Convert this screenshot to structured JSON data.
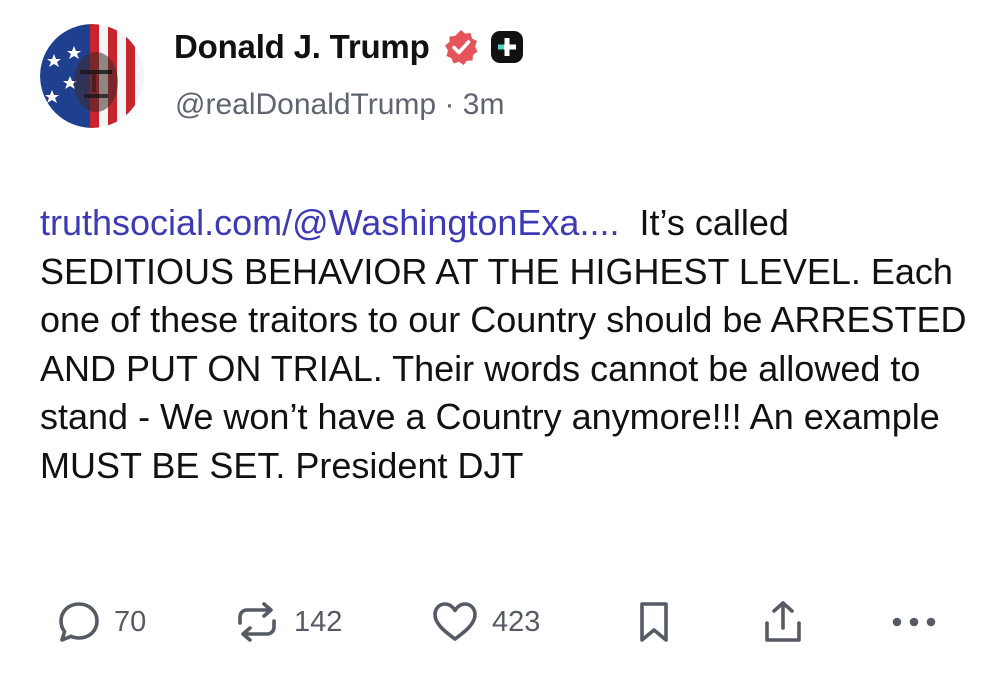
{
  "post": {
    "author": {
      "display_name": "Donald J. Trump",
      "handle": "@realDonaldTrump",
      "separator": "·",
      "time_ago": "3m",
      "verified": true
    },
    "link_text": "truthsocial.com/@WashingtonExa....",
    "text": "It’s called SEDITIOUS BEHAVIOR AT THE HIGHEST LEVEL. Each one of these traitors to our Country should be ARRESTED AND PUT ON TRIAL. Their words cannot be allowed to stand - We won’t have a Country anymore!!! An example MUST BE SET. President DJT",
    "actions": {
      "replies": "70",
      "reposts": "142",
      "likes": "423"
    }
  },
  "icons": {
    "verified": "verified-badge-icon",
    "subscriber": "plus-badge-icon",
    "reply": "speech-bubble-icon",
    "repost": "repost-arrows-icon",
    "like": "heart-icon",
    "bookmark": "bookmark-icon",
    "share": "share-upload-icon",
    "more": "more-dots-icon"
  },
  "colors": {
    "link": "#3d3ab8",
    "verified_badge": "#e5545a",
    "secondary_text": "#5f6470",
    "icon": "#555a64"
  }
}
